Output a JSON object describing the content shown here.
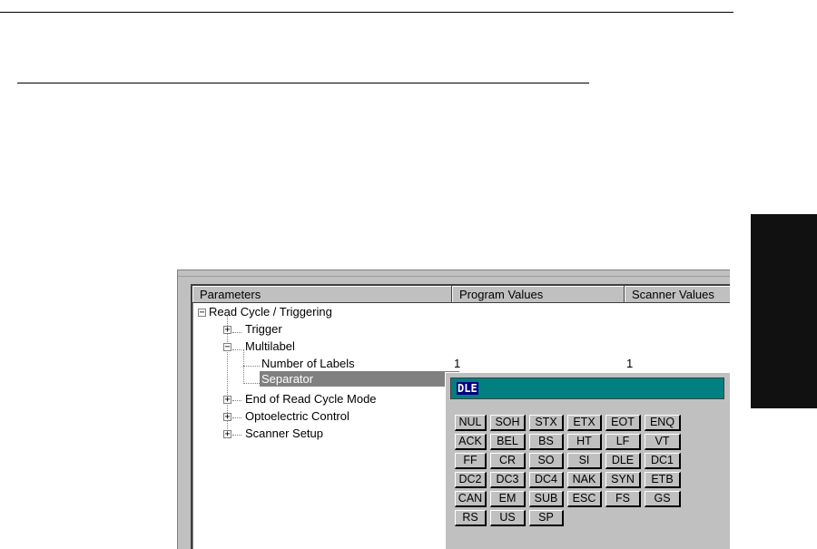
{
  "tree": {
    "columns": [
      "Parameters",
      "Program Values",
      "Scanner Values"
    ],
    "items": [
      {
        "label": "Read Cycle / Triggering",
        "toggle": "−"
      },
      {
        "label": "Trigger",
        "toggle": "+"
      },
      {
        "label": "Multilabel",
        "toggle": "−"
      },
      {
        "label": "Number of Labels",
        "program": "1",
        "scanner": "1"
      },
      {
        "label": "Separator"
      },
      {
        "label": "End of Read Cycle Mode",
        "toggle": "+"
      },
      {
        "label": "Optoelectric Control",
        "toggle": "+"
      },
      {
        "label": "Scanner Setup",
        "toggle": "+"
      }
    ]
  },
  "separator_popup": {
    "value": "DLE",
    "keys": [
      [
        "NUL",
        "SOH",
        "STX",
        "ETX",
        "EOT",
        "ENQ"
      ],
      [
        "ACK",
        "BEL",
        "BS",
        "HT",
        "LF",
        "VT"
      ],
      [
        "FF",
        "CR",
        "SO",
        "SI",
        "DLE",
        "DC1"
      ],
      [
        "DC2",
        "DC3",
        "DC4",
        "NAK",
        "SYN",
        "ETB"
      ],
      [
        "CAN",
        "EM",
        "SUB",
        "ESC",
        "FS",
        "GS"
      ],
      [
        "RS",
        "US",
        "SP"
      ]
    ]
  },
  "colors": {
    "window_gray": "#c0c0c0",
    "field_teal": "#008080",
    "selection_navy": "#000080",
    "selected_row_gray": "#808080"
  }
}
